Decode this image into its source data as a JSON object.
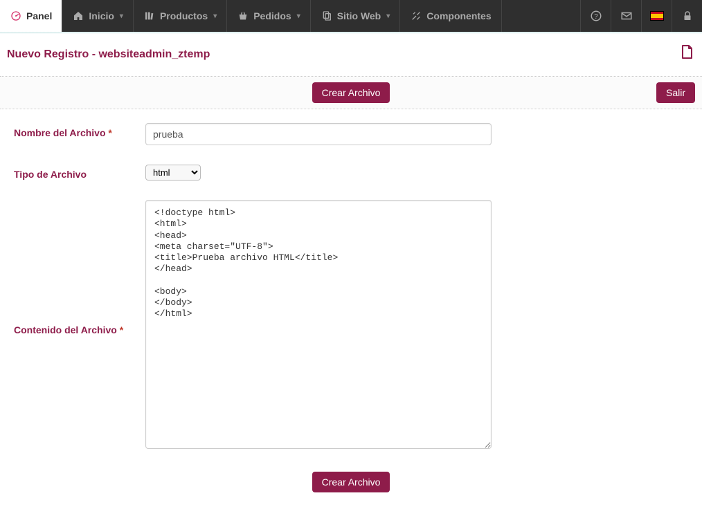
{
  "nav": {
    "tabs": [
      {
        "label": "Panel",
        "active": true,
        "icon": "gauge-icon",
        "caret": false
      },
      {
        "label": "Inicio",
        "active": false,
        "icon": "home-icon",
        "caret": true
      },
      {
        "label": "Productos",
        "active": false,
        "icon": "books-icon",
        "caret": true
      },
      {
        "label": "Pedidos",
        "active": false,
        "icon": "basket-icon",
        "caret": true
      },
      {
        "label": "Sitio Web",
        "active": false,
        "icon": "copy-icon",
        "caret": true
      },
      {
        "label": "Componentes",
        "active": false,
        "icon": "tools-icon",
        "caret": false
      }
    ]
  },
  "header": {
    "title": "Nuevo Registro - websiteadmin_ztemp"
  },
  "actions": {
    "create_label": "Crear Archivo",
    "exit_label": "Salir"
  },
  "form": {
    "filename_label": "Nombre del Archivo",
    "filename_required": "*",
    "filename_value": "prueba",
    "filetype_label": "Tipo de Archivo",
    "filetype_value": "html",
    "filetype_options": [
      "html"
    ],
    "content_label": "Contenido del Archivo",
    "content_required": "*",
    "content_value": "<!doctype html>\n<html>\n<head>\n<meta charset=\"UTF-8\">\n<title>Prueba archivo HTML</title>\n</head>\n\n<body>\n</body>\n</html>"
  },
  "bottom": {
    "create_label": "Crear Archivo"
  }
}
